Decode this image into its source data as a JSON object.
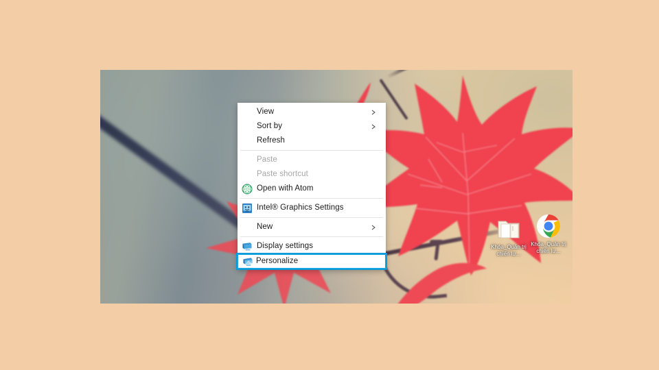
{
  "page": {
    "background_color": "#f3cda5"
  },
  "desktop": {
    "wallpaper_description": "Blurred photograph of red maple leaves on dark branches",
    "colors": {
      "wallpaper_peach": "#f0cfa4",
      "wallpaper_grey_green": "#8e9a95",
      "leaf_red": "#f04a52",
      "branch_dark": "#3b3346"
    },
    "icons": [
      {
        "name": "folder-icon",
        "label": "Khóa_Quản trị chiến lư...",
        "type": "folder"
      },
      {
        "name": "chrome-icon",
        "label": "Khóa_Quản trị chiến lư...",
        "type": "google-chrome"
      }
    ]
  },
  "context_menu": {
    "highlight_color": "#13a3e0",
    "background_color": "#ffffff",
    "text_color": "#1a1a1a",
    "disabled_text_color": "#a6a6a6",
    "items": [
      {
        "label": "View",
        "icon": null,
        "submenu": true,
        "disabled": false,
        "selected": false
      },
      {
        "label": "Sort by",
        "icon": null,
        "submenu": true,
        "disabled": false,
        "selected": false
      },
      {
        "label": "Refresh",
        "icon": null,
        "submenu": false,
        "disabled": false,
        "selected": false
      },
      {
        "label": "Paste",
        "icon": null,
        "submenu": false,
        "disabled": true,
        "selected": false
      },
      {
        "label": "Paste shortcut",
        "icon": null,
        "submenu": false,
        "disabled": true,
        "selected": false
      },
      {
        "label": "Open with Atom",
        "icon": "atom-icon",
        "submenu": false,
        "disabled": false,
        "selected": false
      },
      {
        "label": "Intel® Graphics Settings",
        "icon": "intel-graphics-icon",
        "submenu": false,
        "disabled": false,
        "selected": false
      },
      {
        "label": "New",
        "icon": null,
        "submenu": true,
        "disabled": false,
        "selected": false
      },
      {
        "label": "Display settings",
        "icon": "display-monitor-icon",
        "submenu": false,
        "disabled": false,
        "selected": false
      },
      {
        "label": "Personalize",
        "icon": "personalize-monitor-icon",
        "submenu": false,
        "disabled": false,
        "selected": true
      }
    ]
  }
}
